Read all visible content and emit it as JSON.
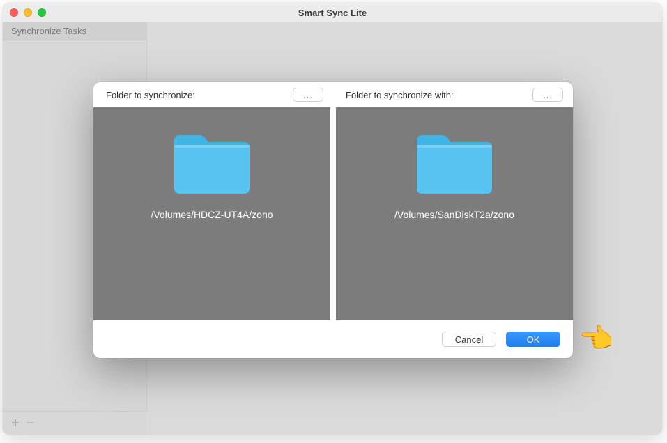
{
  "window": {
    "title": "Smart Sync Lite"
  },
  "sidebar": {
    "items": [
      {
        "label": "Synchronize Tasks"
      }
    ]
  },
  "toolbar": {
    "add_label": "+",
    "remove_label": "−"
  },
  "dialog": {
    "left": {
      "header": "Folder to synchronize:",
      "more": "...",
      "path": "/Volumes/HDCZ-UT4A/zono"
    },
    "right": {
      "header": "Folder to synchronize with:",
      "more": "...",
      "path": "/Volumes/SanDiskT2a/zono"
    },
    "buttons": {
      "cancel": "Cancel",
      "ok": "OK"
    }
  },
  "icons": {
    "folder_fill": "#58c3f0",
    "folder_tab": "#3fb4e6"
  },
  "pointer": {
    "glyph": "👉"
  }
}
